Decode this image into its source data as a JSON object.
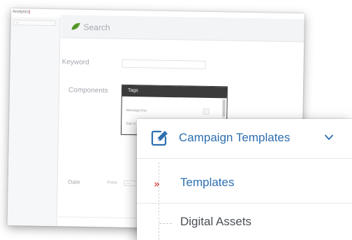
{
  "app": {
    "label": "Analytics"
  },
  "search_panel": {
    "title": "Search",
    "fields": {
      "keyword_label": "Keyword",
      "components_label": "Components",
      "date_label": "Date",
      "date_from_label": "From",
      "date_from_value": "—"
    },
    "tags_popup": {
      "title": "Tags",
      "items": [
        "Message line",
        "Sub in"
      ]
    }
  },
  "menu": {
    "title": "Campaign Templates",
    "items": [
      {
        "label": "Templates",
        "state": "active"
      },
      {
        "label": "Digital Assets",
        "state": "inactive"
      }
    ]
  },
  "colors": {
    "accent_blue": "#2e6fb0",
    "active_arrow_red": "#d2322d",
    "leaf_green": "#5aa02c",
    "tags_header_dark": "#3b3b3b"
  },
  "icons": {
    "search_header": "leaf-icon",
    "menu_header": "edit-icon",
    "menu_toggle": "chevron-down-icon",
    "active_item": "double-chevron-right-icon",
    "inactive_item": "tree-branch-icon"
  }
}
